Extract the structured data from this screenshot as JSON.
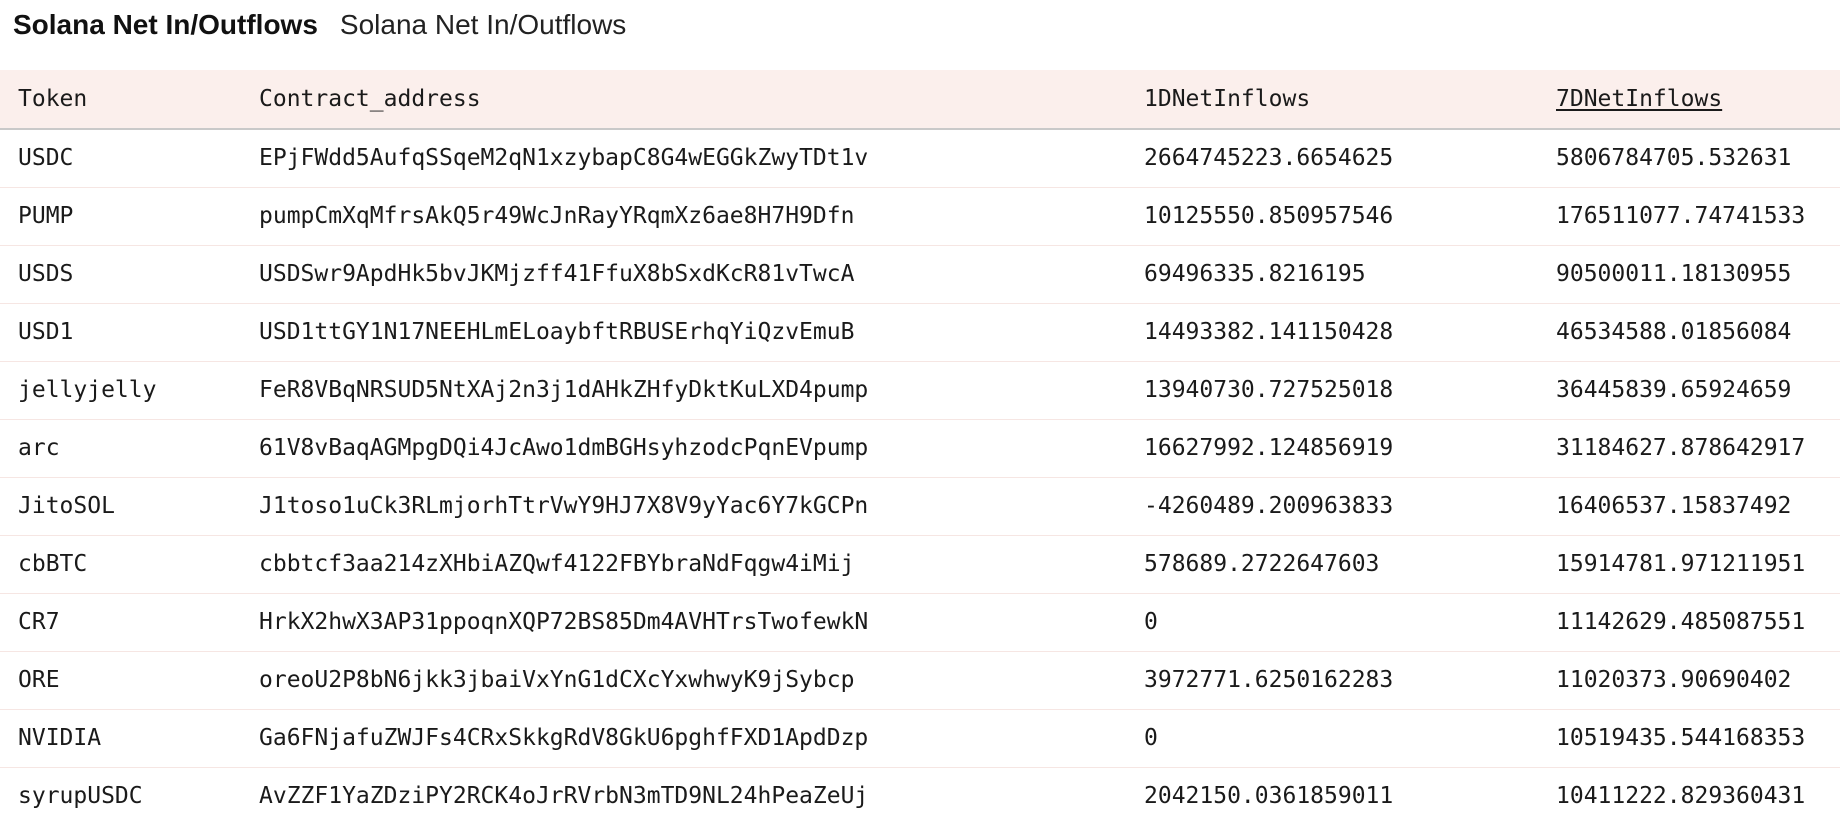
{
  "header": {
    "title": "Solana Net In/Outflows",
    "subtitle": "Solana Net In/Outflows"
  },
  "table": {
    "columns": [
      "Token",
      "Contract_address",
      "1DNetInflows",
      "7DNetInflows"
    ],
    "sorted_column": "7DNetInflows",
    "rows": [
      [
        "USDC",
        "EPjFWdd5AufqSSqeM2qN1xzybapC8G4wEGGkZwyTDt1v",
        "2664745223.6654625",
        "5806784705.532631"
      ],
      [
        "PUMP",
        "pumpCmXqMfrsAkQ5r49WcJnRayYRqmXz6ae8H7H9Dfn",
        "10125550.850957546",
        "176511077.74741533"
      ],
      [
        "USDS",
        "USDSwr9ApdHk5bvJKMjzff41FfuX8bSxdKcR81vTwcA",
        "69496335.8216195",
        "90500011.18130955"
      ],
      [
        "USD1",
        "USD1ttGY1N17NEEHLmELoaybftRBUSErhqYiQzvEmuB",
        "14493382.141150428",
        "46534588.01856084"
      ],
      [
        "jellyjelly",
        "FeR8VBqNRSUD5NtXAj2n3j1dAHkZHfyDktKuLXD4pump",
        "13940730.727525018",
        "36445839.65924659"
      ],
      [
        "arc",
        "61V8vBaqAGMpgDQi4JcAwo1dmBGHsyhzodcPqnEVpump",
        "16627992.124856919",
        "31184627.878642917"
      ],
      [
        "JitoSOL",
        "J1toso1uCk3RLmjorhTtrVwY9HJ7X8V9yYac6Y7kGCPn",
        "-4260489.200963833",
        "16406537.15837492"
      ],
      [
        "cbBTC",
        "cbbtcf3aa214zXHbiAZQwf4122FBYbraNdFqgw4iMij",
        "578689.2722647603",
        "15914781.971211951"
      ],
      [
        "CR7",
        "HrkX2hwX3AP31ppoqnXQP72BS85Dm4AVHTrsTwofewkN",
        "0",
        "11142629.485087551"
      ],
      [
        "ORE",
        "oreoU2P8bN6jkk3jbaiVxYnG1dCXcYxwhwyK9jSybcp",
        "3972771.6250162283",
        "11020373.90690402"
      ],
      [
        "NVIDIA",
        "Ga6FNjafuZWJFs4CRxSkkgRdV8GkU6pghfFXD1ApdDzp",
        "0",
        "10519435.544168353"
      ],
      [
        "syrupUSDC",
        "AvZZF1YaZDziPY2RCK4oJrRVrbN3mTD9NL24hPeaZeUj",
        "2042150.0361859011",
        "10411222.829360431"
      ]
    ]
  }
}
